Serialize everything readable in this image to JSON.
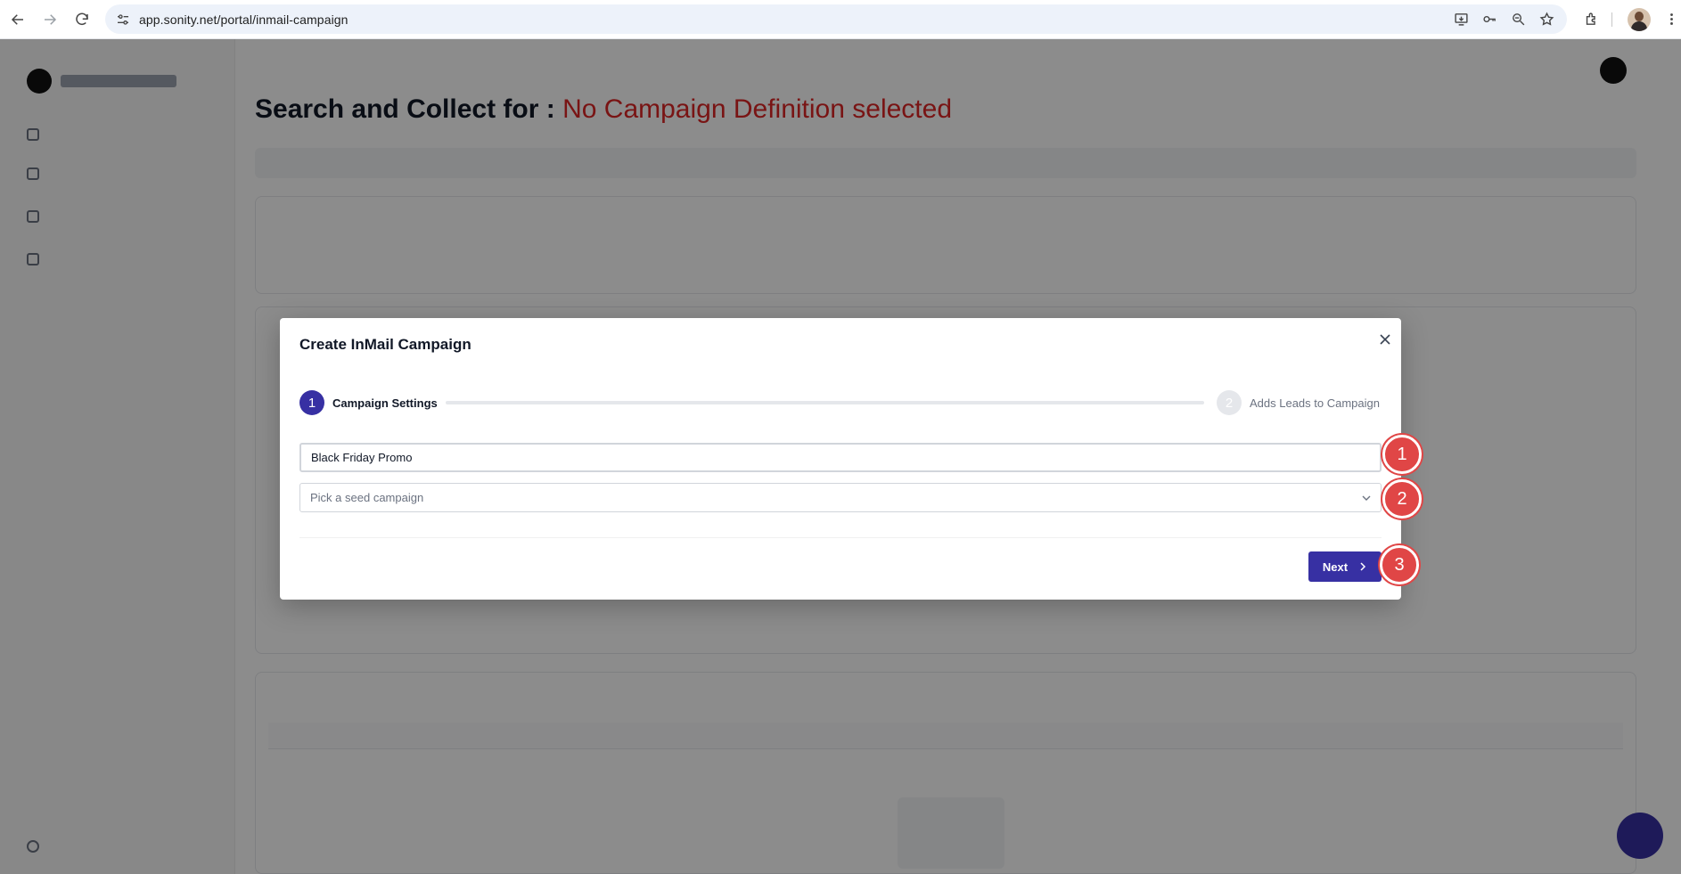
{
  "browser": {
    "url": "app.sonity.net/portal/inmail-campaign",
    "icons": [
      "back-arrow-icon",
      "forward-arrow-icon",
      "reload-icon",
      "site-settings-icon",
      "install-app-icon",
      "password-key-icon",
      "zoom-icon",
      "bookmark-star-icon",
      "extensions-icon",
      "profile-avatar",
      "more-vert-icon"
    ]
  },
  "background": {
    "page_title": "Search and Collect for :",
    "page_title_warning": "No Campaign Definition selected"
  },
  "modal": {
    "title": "Create InMail Campaign",
    "steps": [
      {
        "number": "1",
        "label": "Campaign Settings",
        "active": true
      },
      {
        "number": "2",
        "label": "Adds Leads to Campaign",
        "active": false
      }
    ],
    "campaign_name_value": "Black Friday Promo",
    "seed_campaign_placeholder": "Pick a seed campaign",
    "next_label": "Next"
  },
  "markers": [
    "1",
    "2",
    "3"
  ],
  "colors": {
    "primary": "#3730a3",
    "marker": "#e04646",
    "warning": "#dc2626",
    "overlay": "rgba(0,0,0,0.45)"
  }
}
